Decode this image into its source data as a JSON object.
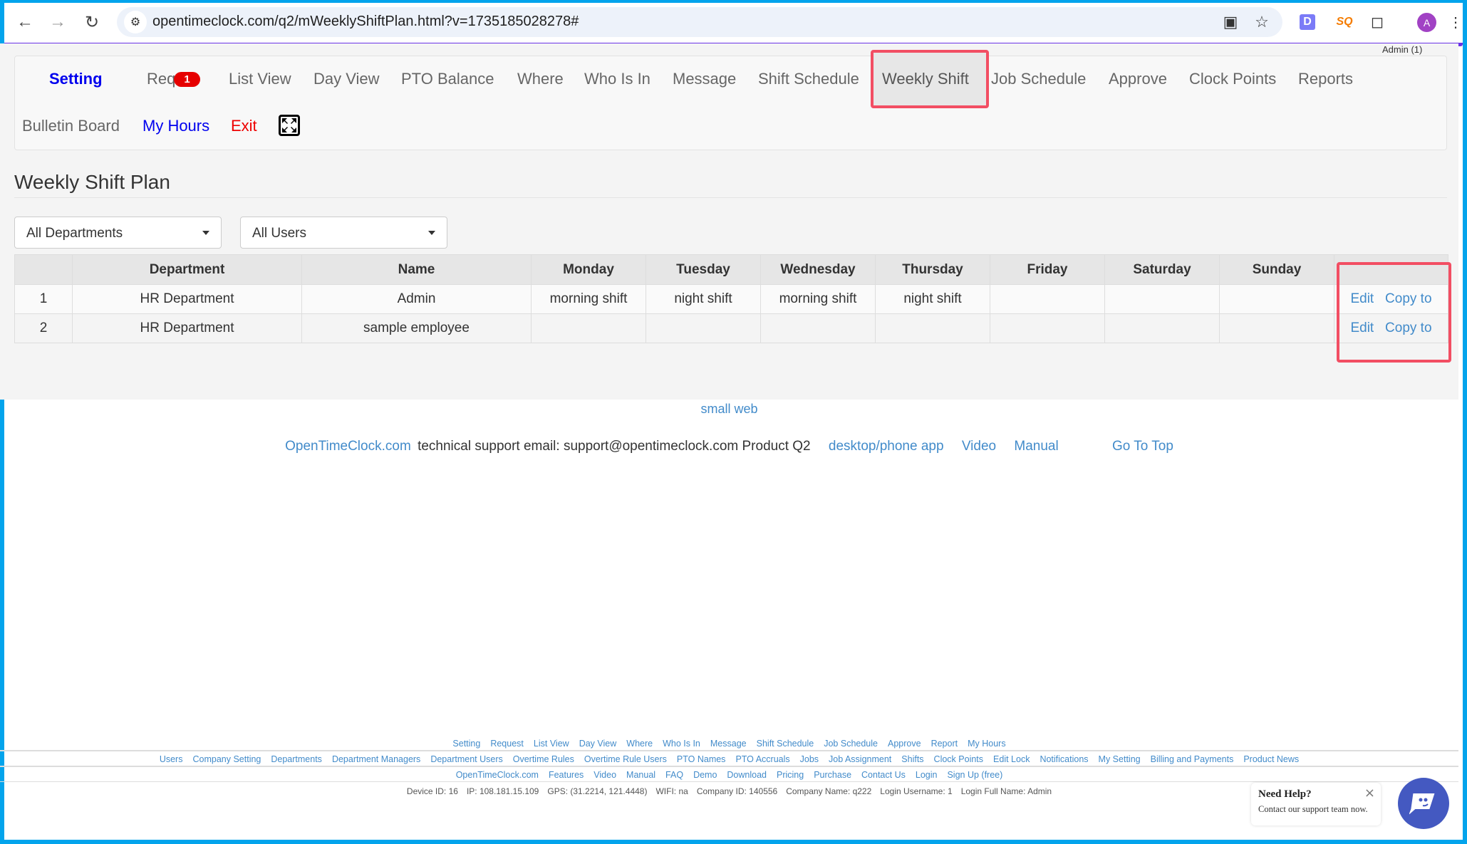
{
  "browser": {
    "url": "opentimeclock.com/q2/mWeeklyShiftPlan.html?v=1735185028278#",
    "icons": [
      "back-icon",
      "forward-icon",
      "reload-icon",
      "site-settings-icon",
      "install-app-icon",
      "bookmark-star-icon",
      "extension-d-icon",
      "extension-sq-icon",
      "extensions-puzzle-icon",
      "profile-avatar",
      "menu-icon"
    ],
    "avatar_letter": "A"
  },
  "user_label": "Admin (1)",
  "nav": {
    "row1": [
      {
        "label": "Setting",
        "color": "#0000ee",
        "bold": true
      },
      {
        "label": "Req",
        "badge": "1"
      },
      {
        "label": "List View"
      },
      {
        "label": "Day View"
      },
      {
        "label": "PTO Balance"
      },
      {
        "label": "Where"
      },
      {
        "label": "Who Is In"
      },
      {
        "label": "Message"
      },
      {
        "label": "Shift Schedule"
      },
      {
        "label": "Weekly Shift",
        "active": true
      },
      {
        "label": "Job Schedule"
      },
      {
        "label": "Approve"
      },
      {
        "label": "Clock Points"
      },
      {
        "label": "Reports"
      }
    ],
    "row2": [
      {
        "label": "Bulletin Board"
      },
      {
        "label": "My Hours",
        "color": "#0000ee"
      },
      {
        "label": "Exit",
        "color": "#ee0000"
      }
    ],
    "fullscreen_icon": "fullscreen-icon"
  },
  "page": {
    "title": "Weekly Shift Plan",
    "department_select": "All Departments",
    "user_select": "All Users"
  },
  "table": {
    "headers": [
      "",
      "Department",
      "Name",
      "Monday",
      "Tuesday",
      "Wednesday",
      "Thursday",
      "Friday",
      "Saturday",
      "Sunday",
      ""
    ],
    "rows": [
      {
        "num": "1",
        "department": "HR Department",
        "name": "Admin",
        "days": [
          "morning shift",
          "night shift",
          "morning shift",
          "night shift",
          "",
          "",
          ""
        ],
        "edit": "Edit",
        "copy": "Copy to"
      },
      {
        "num": "2",
        "department": "HR Department",
        "name": "sample employee",
        "days": [
          "",
          "",
          "",
          "",
          "",
          "",
          ""
        ],
        "edit": "Edit",
        "copy": "Copy to"
      }
    ]
  },
  "footer": {
    "small_web": "small web",
    "support": {
      "site_link": "OpenTimeClock.com",
      "text": "technical support email: support@opentimeclock.com Product Q2",
      "links": [
        "desktop/phone app",
        "Video",
        "Manual"
      ],
      "go_top": "Go To Top"
    },
    "links_row1": [
      "Setting",
      "Request",
      "List View",
      "Day View",
      "Where",
      "Who Is In",
      "Message",
      "Shift Schedule",
      "Job Schedule",
      "Approve",
      "Report",
      "My Hours"
    ],
    "links_row2": [
      "Users",
      "Company Setting",
      "Departments",
      "Department Managers",
      "Department Users",
      "Overtime Rules",
      "Overtime Rule Users",
      "PTO Names",
      "PTO Accruals",
      "Jobs",
      "Job Assignment",
      "Shifts",
      "Clock Points",
      "Edit Lock",
      "Notifications",
      "My Setting",
      "Billing and Payments",
      "Product News"
    ],
    "links_row3": [
      "OpenTimeClock.com",
      "Features",
      "Video",
      "Manual",
      "FAQ",
      "Demo",
      "Download",
      "Pricing",
      "Purchase",
      "Contact Us",
      "Login",
      "Sign Up (free)"
    ],
    "info": [
      "Device ID: 16",
      "IP: 108.181.15.109",
      "GPS: (31.2214, 121.4448)",
      "WIFI: na",
      "Company ID: 140556",
      "Company Name: q222",
      "Login Username: 1",
      "Login Full Name: Admin"
    ]
  },
  "help_widget": {
    "title": "Need Help?",
    "subtitle": "Contact our support team now.",
    "close": "×"
  },
  "colors": {
    "link": "#428bca",
    "highlight_box": "#f24e63",
    "badge": "#e60000",
    "frame": "#03a4ec",
    "chat": "#4459c1"
  }
}
